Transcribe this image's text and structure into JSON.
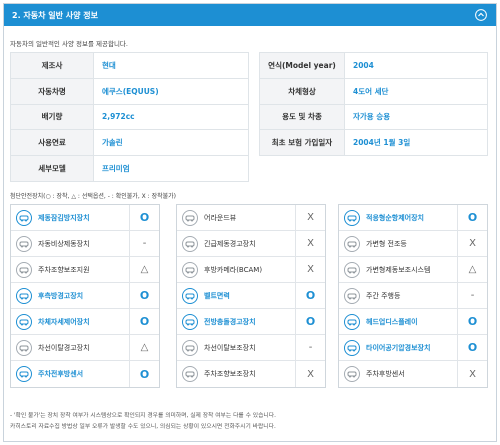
{
  "header": {
    "title": "2. 자동차 일반 사양 정보"
  },
  "intro": "자동차의 일반적인 사양 정보를 제공합니다.",
  "spec_left": [
    {
      "label": "제조사",
      "value": "현대"
    },
    {
      "label": "자동차명",
      "value": "에쿠스(EQUUS)"
    },
    {
      "label": "배기량",
      "value": "2,972cc"
    },
    {
      "label": "사용연료",
      "value": "가솔린"
    },
    {
      "label": "세부모델",
      "value": "프리미엄"
    }
  ],
  "spec_right": [
    {
      "label": "연식(Model year)",
      "value": "2004"
    },
    {
      "label": "차체형상",
      "value": "4도어 세단"
    },
    {
      "label": "용도 및 차종",
      "value": "자가용 승용"
    },
    {
      "label": "최초 보험 가입일자",
      "value": "2004년 1월 3일"
    }
  ],
  "legend": "첨단안전장치(○ : 장착, △ : 선택옵션, - : 확인불가, X : 장착불가)",
  "safety": {
    "col1": [
      {
        "name": "제동잠김방지장치",
        "status": "O",
        "on": true,
        "icon": "abs-icon"
      },
      {
        "name": "자동비상제동장치",
        "status": "-",
        "on": false,
        "icon": "aeb-icon"
      },
      {
        "name": "주차조향보조지원",
        "status": "△",
        "on": false,
        "icon": "parking-assist-icon"
      },
      {
        "name": "후측방경고장치",
        "status": "O",
        "on": true,
        "icon": "rear-side-warning-icon"
      },
      {
        "name": "차체자세제어장치",
        "status": "O",
        "on": true,
        "icon": "esc-icon"
      },
      {
        "name": "차선이탈경고장치",
        "status": "△",
        "on": false,
        "icon": "lane-departure-icon"
      },
      {
        "name": "주차전후방센서",
        "status": "O",
        "on": true,
        "icon": "parking-sensor-icon"
      }
    ],
    "col2": [
      {
        "name": "어라운드뷰",
        "status": "X",
        "on": false,
        "icon": "around-view-icon"
      },
      {
        "name": "긴급제동경고장치",
        "status": "X",
        "on": false,
        "icon": "emergency-brake-warning-icon"
      },
      {
        "name": "후방카메라(BCAM)",
        "status": "X",
        "on": false,
        "icon": "rear-camera-icon"
      },
      {
        "name": "벨트면력",
        "status": "O",
        "on": true,
        "icon": "seatbelt-icon"
      },
      {
        "name": "전방충돌경고장치",
        "status": "O",
        "on": true,
        "icon": "forward-collision-icon"
      },
      {
        "name": "차선이탈보조장치",
        "status": "-",
        "on": false,
        "icon": "lane-keep-icon"
      },
      {
        "name": "주차조향보조장치",
        "status": "X",
        "on": false,
        "icon": "steering-assist-icon"
      }
    ],
    "col3": [
      {
        "name": "적응형순항제어장치",
        "status": "O",
        "on": true,
        "icon": "cruise-control-icon"
      },
      {
        "name": "가변형 전조등",
        "status": "X",
        "on": false,
        "icon": "adaptive-headlight-icon"
      },
      {
        "name": "가변형제동보조시스템",
        "status": "△",
        "on": false,
        "icon": "brake-assist-icon"
      },
      {
        "name": "주간 주행등",
        "status": "-",
        "on": false,
        "icon": "daytime-light-icon"
      },
      {
        "name": "헤드업디스플레이",
        "status": "O",
        "on": true,
        "icon": "hud-icon"
      },
      {
        "name": "타이어공기압경보장치",
        "status": "O",
        "on": true,
        "icon": "tpms-icon"
      },
      {
        "name": "주차후방센서",
        "status": "X",
        "on": false,
        "icon": "rear-sensor-icon"
      }
    ]
  },
  "footnotes": [
    "- '확인 불가'는 장치 장착 여부가 시스템상으로 확인되지 경우를 의미하며, 실제 장착 여부는 다를 수 있습니다.",
    "  카히스토리 자료수집 방법상 일부 오류가 발생할 수도 있으니, 의심되는 상황이 있으시면 전화주시기 바랍니다."
  ],
  "colors": {
    "accent": "#1d8fd3",
    "label_bg": "#f3f4f6",
    "border": "#dfe4e8"
  }
}
